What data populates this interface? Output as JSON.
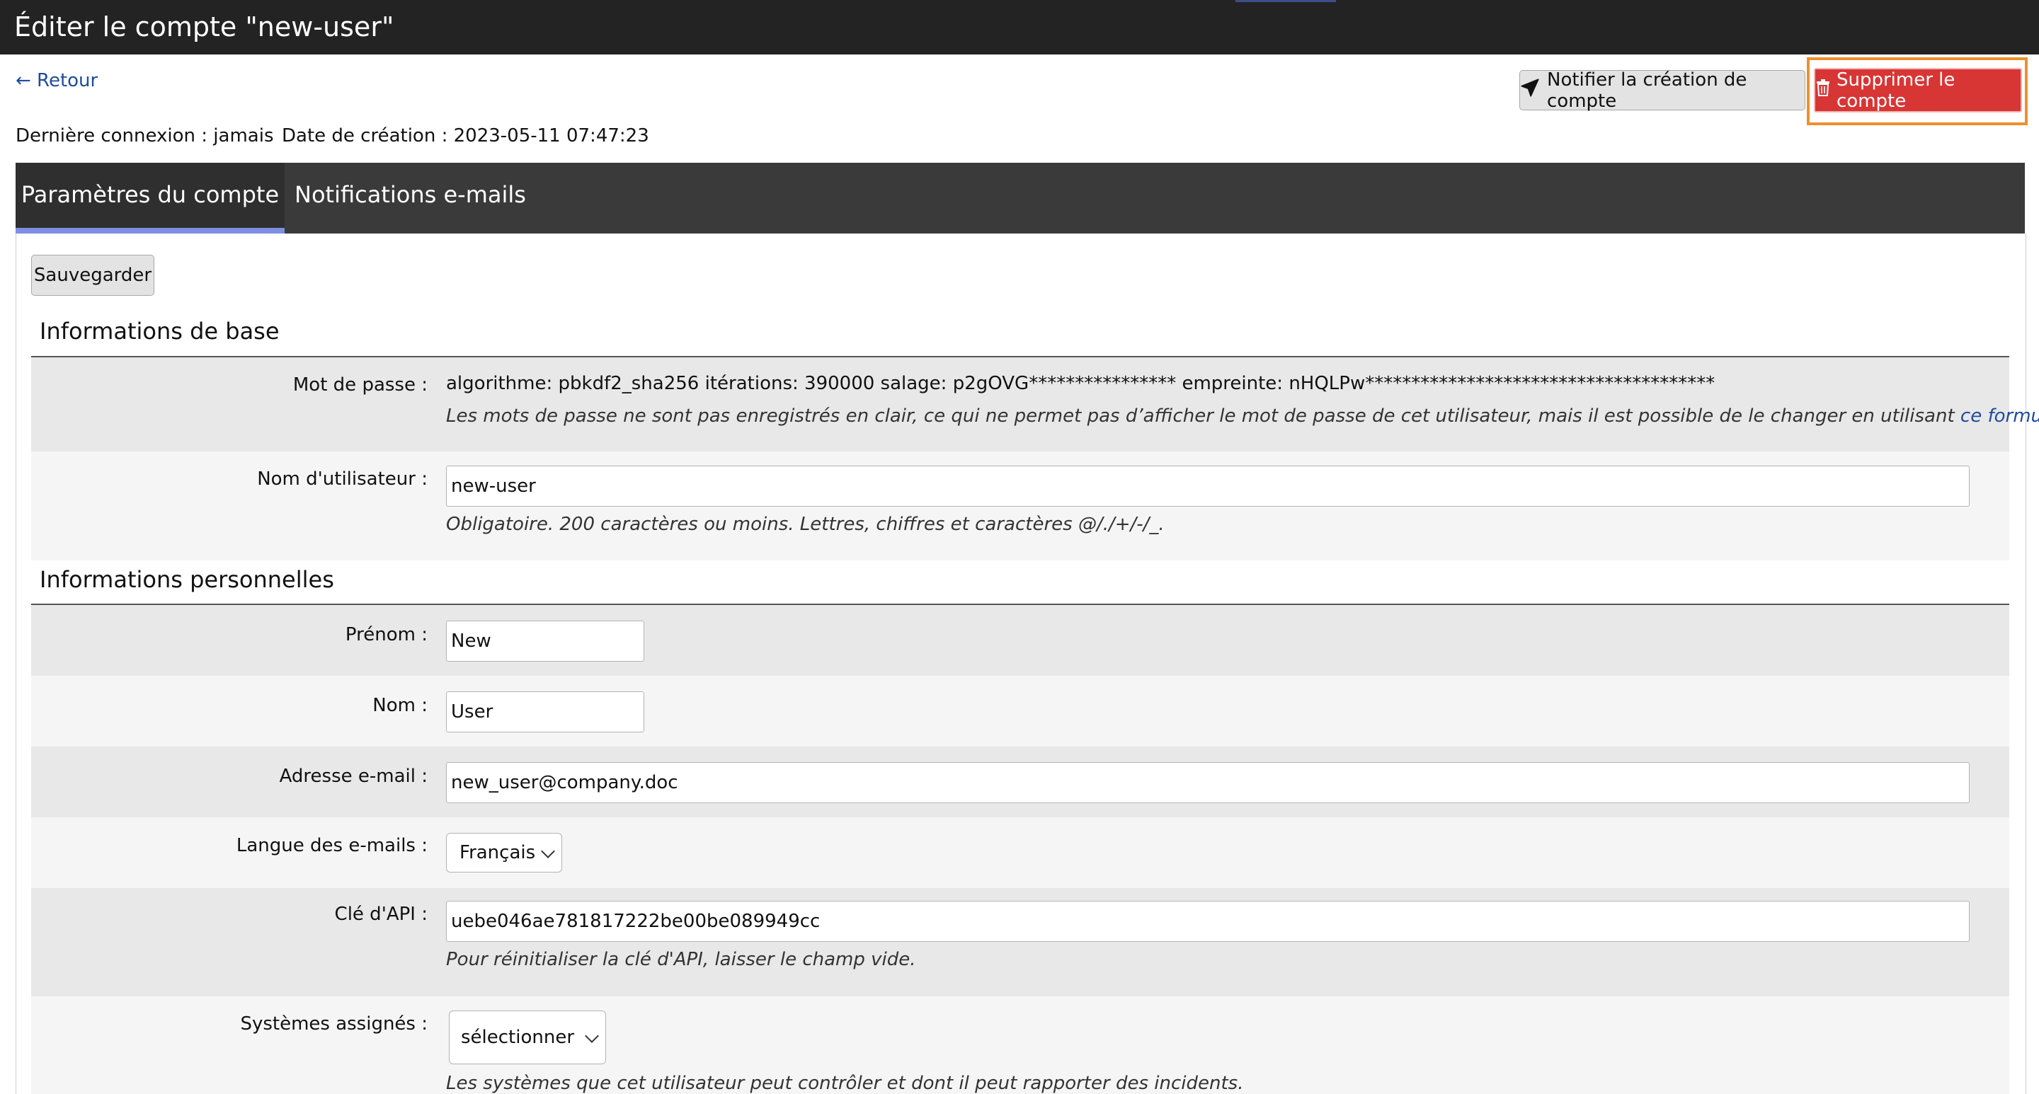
{
  "header": {
    "title": "Éditer le compte \"new-user\""
  },
  "nav": {
    "back_label": "← Retour"
  },
  "actions": {
    "notify_label": "Notifier la création de compte",
    "notify_icon": "paper-plane-icon",
    "delete_label": "Supprimer le compte",
    "delete_icon": "trash-icon"
  },
  "meta": {
    "last_login": "Dernière connexion : jamais",
    "created": "Date de création : 2023-05-11 07:47:23"
  },
  "tabs": [
    {
      "label": "Paramètres du compte",
      "active": true
    },
    {
      "label": "Notifications e-mails",
      "active": false
    }
  ],
  "form": {
    "save_label": "Sauvegarder",
    "sections": {
      "basic": "Informations de base",
      "personal": "Informations personnelles"
    },
    "password": {
      "label": "Mot de passe :",
      "value": "algorithme: pbkdf2_sha256 itérations: 390000 salage: p2gOVG**************** empreinte: nHQLPw**************************************",
      "help_text": "Les mots de passe ne sont pas enregistrés en clair, ce qui ne permet pas d’afficher le mot de passe de cet utilisateur, mais il est possible de le changer en utilisant ",
      "help_link": "ce formulaire",
      "help_end": "."
    },
    "username": {
      "label": "Nom d'utilisateur :",
      "value": "new-user",
      "help": "Obligatoire. 200 caractères ou moins. Lettres, chiffres et caractères @/./+/-/_."
    },
    "first_name": {
      "label": "Prénom :",
      "value": "New"
    },
    "last_name": {
      "label": "Nom :",
      "value": "User"
    },
    "email": {
      "label": "Adresse e-mail :",
      "value": "new_user@company.doc"
    },
    "email_language": {
      "label": "Langue des e-mails :",
      "value": "Français"
    },
    "api_key": {
      "label": "Clé d'API :",
      "value": "uebe046ae781817222be00be089949cc",
      "help": "Pour réinitialiser la clé d'API, laisser le champ vide."
    },
    "systems": {
      "label": "Systèmes assignés :",
      "value": "sélectionner",
      "help": "Les systèmes que cet utilisateur peut contrôler et dont il peut rapporter des incidents."
    }
  },
  "colors": {
    "titlebar": "#232323",
    "tabbar": "#3a3a3a",
    "tab_underline": "#7d8fe0",
    "delete_button": "#d83535",
    "highlight": "#ef8f2c",
    "link": "#1f4b9c"
  }
}
